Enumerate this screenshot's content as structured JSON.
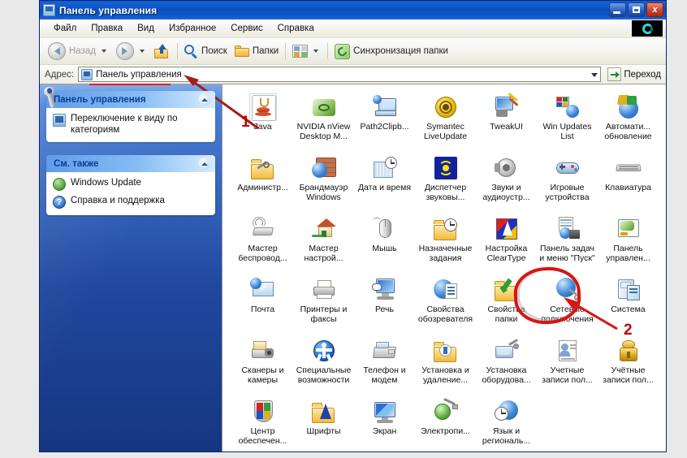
{
  "window": {
    "title": "Панель управления",
    "controls": {
      "minimize": "–",
      "maximize": "□",
      "close": "x"
    }
  },
  "menubar": {
    "items": [
      "Файл",
      "Правка",
      "Вид",
      "Избранное",
      "Сервис",
      "Справка"
    ],
    "logo_icon": "teal-ring-icon"
  },
  "toolbar": {
    "back": "Назад",
    "forward": "",
    "up": "",
    "search": "Поиск",
    "folders": "Папки",
    "views": "",
    "sync": "Синхронизация папки"
  },
  "address": {
    "label": "Адрес:",
    "value": "Панель управления",
    "go": "Переход"
  },
  "sidebar": {
    "panels": [
      {
        "title": "Панель управления",
        "items": [
          {
            "label": "Переключение к виду по категориям",
            "icon": "control-panel-icon"
          }
        ]
      },
      {
        "title": "См. также",
        "items": [
          {
            "label": "Windows Update",
            "icon": "windows-update-icon"
          },
          {
            "label": "Справка и поддержка",
            "icon": "help-support-icon"
          }
        ]
      }
    ]
  },
  "content": {
    "items": [
      {
        "label": "Java",
        "icon": "java-icon"
      },
      {
        "label": "NVIDIA nView Desktop M...",
        "icon": "nvidia-icon"
      },
      {
        "label": "Path2Clipb...",
        "icon": "path2clipboard-icon"
      },
      {
        "label": "Symantec LiveUpdate",
        "icon": "symantec-liveupdate-icon"
      },
      {
        "label": "TweakUI",
        "icon": "tweakui-icon"
      },
      {
        "label": "Win Updates List",
        "icon": "win-updates-list-icon"
      },
      {
        "label": "Автомати... обновление",
        "icon": "automatic-updates-icon"
      },
      {
        "label": "Администр...",
        "icon": "administrative-tools-icon"
      },
      {
        "label": "Брандмауэр Windows",
        "icon": "windows-firewall-icon"
      },
      {
        "label": "Дата и время",
        "icon": "date-time-icon"
      },
      {
        "label": "Диспетчер звуковы...",
        "icon": "sound-manager-icon"
      },
      {
        "label": "Звуки и аудиоустр...",
        "icon": "sounds-audio-icon"
      },
      {
        "label": "Игровые устройства",
        "icon": "game-controllers-icon"
      },
      {
        "label": "Клавиатура",
        "icon": "keyboard-icon"
      },
      {
        "label": "Мастер беспровод...",
        "icon": "wireless-wizard-icon"
      },
      {
        "label": "Мастер настрой...",
        "icon": "network-setup-wizard-icon"
      },
      {
        "label": "Мышь",
        "icon": "mouse-icon"
      },
      {
        "label": "Назначенные задания",
        "icon": "scheduled-tasks-icon"
      },
      {
        "label": "Настройка ClearType",
        "icon": "cleartype-icon"
      },
      {
        "label": "Панель задач и меню \"Пуск\"",
        "icon": "taskbar-startmenu-icon"
      },
      {
        "label": "Панель управлен...",
        "icon": "nvidia-control-panel-icon"
      },
      {
        "label": "Почта",
        "icon": "mail-icon"
      },
      {
        "label": "Принтеры и факсы",
        "icon": "printers-faxes-icon"
      },
      {
        "label": "Речь",
        "icon": "speech-icon"
      },
      {
        "label": "Свойства обозревателя",
        "icon": "internet-options-icon"
      },
      {
        "label": "Свойства папки",
        "icon": "folder-options-icon"
      },
      {
        "label": "Сетевые подключения",
        "icon": "network-connections-icon"
      },
      {
        "label": "Система",
        "icon": "system-icon"
      },
      {
        "label": "Сканеры и камеры",
        "icon": "scanners-cameras-icon"
      },
      {
        "label": "Специальные возможности",
        "icon": "accessibility-icon"
      },
      {
        "label": "Телефон и модем",
        "icon": "phone-modem-icon"
      },
      {
        "label": "Установка и удаление...",
        "icon": "add-remove-programs-icon"
      },
      {
        "label": "Установка оборудова...",
        "icon": "add-hardware-icon"
      },
      {
        "label": "Учетные записи пол...",
        "icon": "user-accounts-icon"
      },
      {
        "label": "Учётные записи пол...",
        "icon": "user-accounts-gold-icon"
      },
      {
        "label": "Центр обеспечен...",
        "icon": "security-center-icon"
      },
      {
        "label": "Шрифты",
        "icon": "fonts-icon"
      },
      {
        "label": "Экран",
        "icon": "display-icon"
      },
      {
        "label": "Электропи...",
        "icon": "power-options-icon"
      },
      {
        "label": "Язык и региональ...",
        "icon": "regional-language-icon"
      }
    ]
  },
  "annotations": {
    "step1": "1",
    "step2": "2"
  }
}
